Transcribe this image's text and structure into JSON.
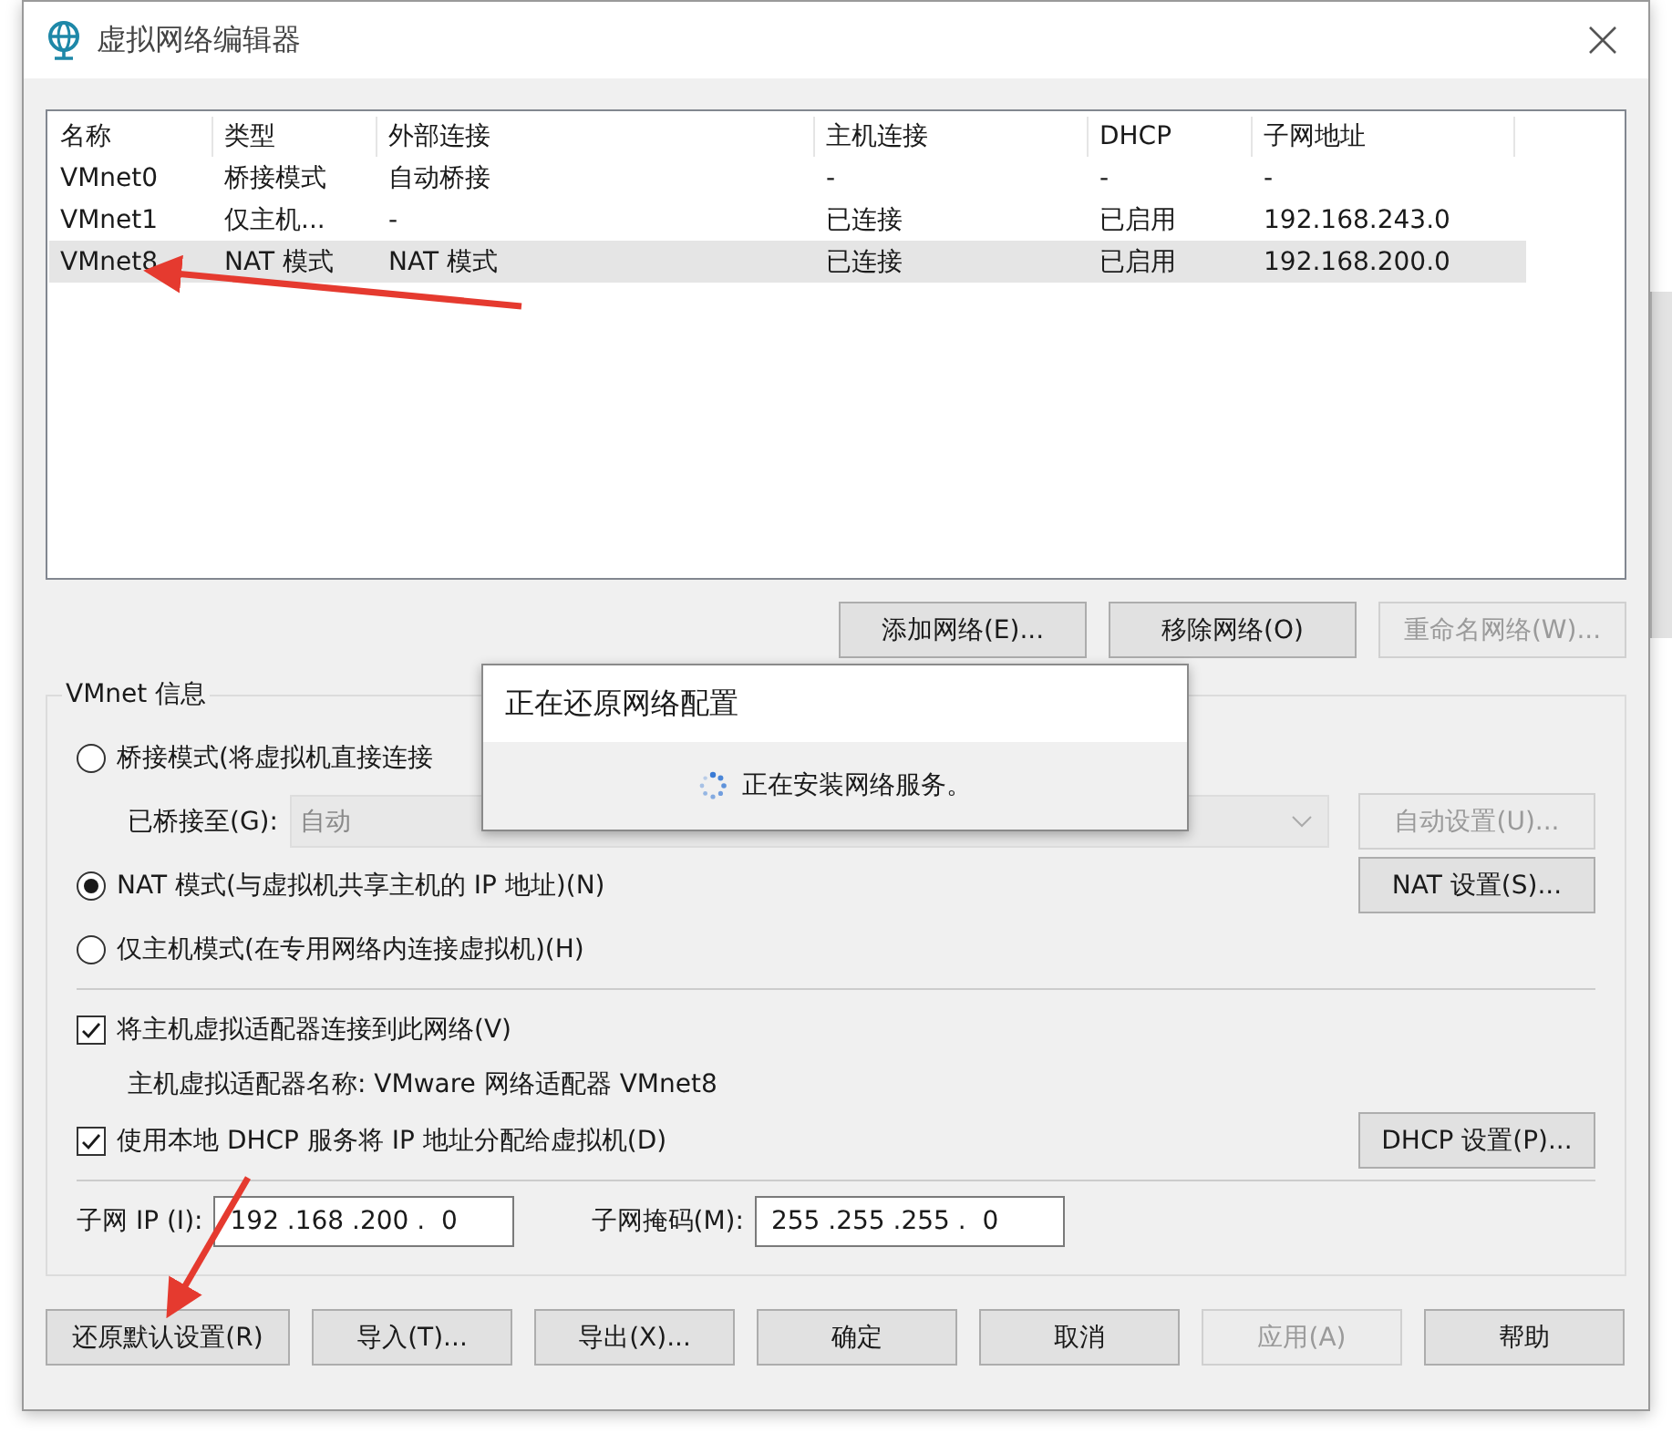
{
  "window": {
    "title": "虚拟网络编辑器"
  },
  "network_table": {
    "columns": [
      "名称",
      "类型",
      "外部连接",
      "主机连接",
      "DHCP",
      "子网地址"
    ],
    "rows": [
      {
        "cells": [
          "VMnet0",
          "桥接模式",
          "自动桥接",
          "-",
          "-",
          "-"
        ],
        "selected": false
      },
      {
        "cells": [
          "VMnet1",
          "仅主机...",
          "-",
          "已连接",
          "已启用",
          "192.168.243.0"
        ],
        "selected": false
      },
      {
        "cells": [
          "VMnet8",
          "NAT 模式",
          "NAT 模式",
          "已连接",
          "已启用",
          "192.168.200.0"
        ],
        "selected": true
      }
    ]
  },
  "network_buttons": [
    {
      "label": "添加网络(E)...",
      "disabled": false
    },
    {
      "label": "移除网络(O)",
      "disabled": false
    },
    {
      "label": "重命名网络(W)...",
      "disabled": true
    }
  ],
  "vmnet_info": {
    "title": "VMnet 信息",
    "modes": [
      {
        "label": "桥接模式(将虚拟机直接连接",
        "selected": false
      },
      {
        "label": "NAT 模式(与虚拟机共享主机的 IP 地址)(N)",
        "selected": true,
        "button": {
          "label": "NAT 设置(S)...",
          "disabled": false
        }
      },
      {
        "label": "仅主机模式(在专用网络内连接虚拟机)(H)",
        "selected": false
      }
    ],
    "bridged_to": {
      "label": "已桥接至(G):",
      "value": "自动",
      "disabled": true,
      "button": {
        "label": "自动设置(U)...",
        "disabled": true
      }
    },
    "host_adapter_checkbox": {
      "label": "将主机虚拟适配器连接到此网络(V)",
      "checked": true
    },
    "adapter_name": "主机虚拟适配器名称: VMware 网络适配器 VMnet8",
    "dhcp_checkbox": {
      "label": "使用本地 DHCP 服务将 IP 地址分配给虚拟机(D)",
      "checked": true,
      "button": {
        "label": "DHCP 设置(P)...",
        "disabled": false
      }
    },
    "subnet_ip": {
      "label": "子网 IP (I):",
      "value": "192 .168 .200 .  0"
    },
    "subnet_mask": {
      "label": "子网掩码(M):",
      "value": "255 .255 .255 .  0"
    }
  },
  "progress_dialog": {
    "title": "正在还原网络配置",
    "message": "正在安装网络服务。"
  },
  "footer_buttons": [
    {
      "label": "还原默认设置(R)",
      "disabled": false
    },
    {
      "label": "导入(T)...",
      "disabled": false
    },
    {
      "label": "导出(X)...",
      "disabled": false
    },
    {
      "label": "确定",
      "disabled": false
    },
    {
      "label": "取消",
      "disabled": false
    },
    {
      "label": "应用(A)",
      "disabled": true
    },
    {
      "label": "帮助",
      "disabled": false
    }
  ]
}
